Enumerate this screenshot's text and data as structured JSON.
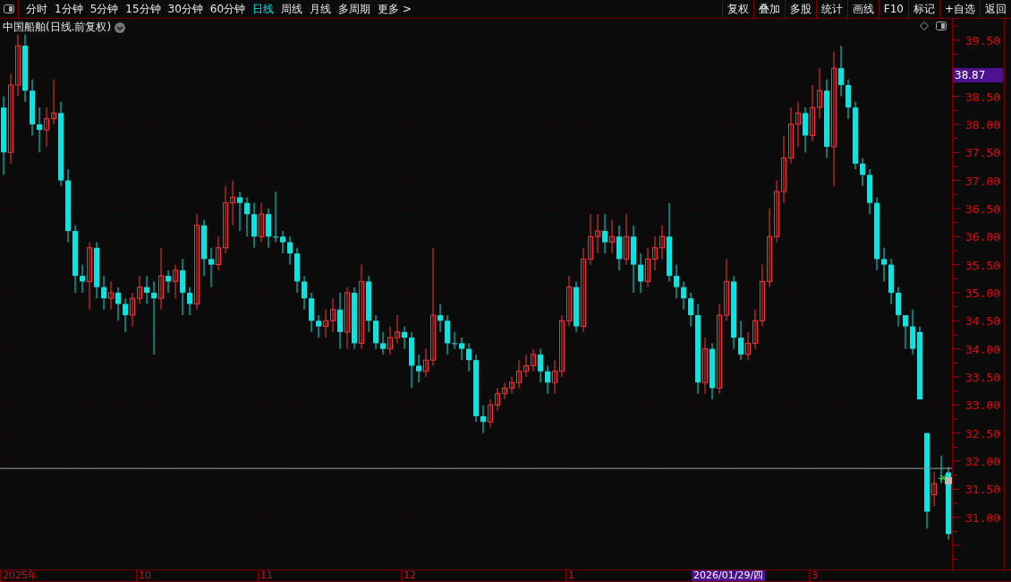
{
  "toolbar": {
    "periods": [
      {
        "label": "分时",
        "selected": false
      },
      {
        "label": "1分钟",
        "selected": false
      },
      {
        "label": "5分钟",
        "selected": false
      },
      {
        "label": "15分钟",
        "selected": false
      },
      {
        "label": "30分钟",
        "selected": false
      },
      {
        "label": "60分钟",
        "selected": false
      },
      {
        "label": "日线",
        "selected": true
      },
      {
        "label": "周线",
        "selected": false
      },
      {
        "label": "月线",
        "selected": false
      },
      {
        "label": "多周期",
        "selected": false
      },
      {
        "label": "更多 >",
        "selected": false
      }
    ],
    "buttons": [
      "复权",
      "叠加",
      "多股",
      "统计",
      "画线",
      "F10",
      "标记",
      "+自选",
      "返回"
    ]
  },
  "chart": {
    "title": "中国船舶(日线.前复权)",
    "date_labels": [
      "2025年",
      "10",
      "11",
      "12",
      "1",
      "3"
    ],
    "cursor_price": "38.87",
    "cursor_date": "2026/01/29/四",
    "chart_data": {
      "type": "candlestick",
      "ylim": [
        30.07,
        39.88
      ],
      "grid": true,
      "yticks": [
        {
          "value": 31,
          "label": "31.00"
        },
        {
          "value": 31.5,
          "label": "31.50"
        },
        {
          "value": 32,
          "label": "32.00"
        },
        {
          "value": 32.5,
          "label": "32.50"
        },
        {
          "value": 33,
          "label": "33.00"
        },
        {
          "value": 33.5,
          "label": "33.50"
        },
        {
          "value": 34,
          "label": "34.00"
        },
        {
          "value": 34.5,
          "label": "34.50"
        },
        {
          "value": 35,
          "label": "35.00"
        },
        {
          "value": 35.5,
          "label": "35.50"
        },
        {
          "value": 36,
          "label": "36.00"
        },
        {
          "value": 36.5,
          "label": "36.50"
        },
        {
          "value": 37,
          "label": "37.00"
        },
        {
          "value": 37.5,
          "label": "37.50"
        },
        {
          "value": 38,
          "label": "38.00"
        },
        {
          "value": 38.5,
          "label": "38.50"
        },
        {
          "value": 39.5,
          "label": "39.50"
        }
      ],
      "ref_lines": [
        {
          "axis": "y",
          "value": 31.87
        }
      ],
      "categories": [
        null,
        null,
        null,
        null,
        null,
        null,
        null,
        null,
        null,
        null,
        null,
        null,
        null,
        null,
        null,
        null,
        null,
        null,
        null,
        null,
        null,
        null,
        null,
        null,
        null,
        null,
        null,
        null,
        null,
        null,
        null,
        null,
        null,
        null,
        null,
        null,
        null,
        null,
        null,
        null,
        null,
        null,
        null,
        null,
        null,
        null,
        null,
        null,
        null,
        null,
        null,
        null,
        null,
        null,
        null,
        null,
        null,
        null,
        null,
        null,
        null,
        null,
        null,
        null,
        null,
        null,
        null,
        null,
        null,
        null,
        null,
        null,
        null,
        null,
        null,
        null,
        null,
        null,
        null,
        null,
        null,
        null,
        null,
        null,
        null,
        null,
        null,
        null,
        null,
        null,
        null,
        null,
        null,
        null,
        null,
        null,
        null,
        null,
        null,
        null,
        null,
        null,
        null,
        null,
        null,
        null,
        null,
        null,
        null,
        null,
        null,
        null,
        null,
        null,
        null,
        null,
        null,
        null,
        null,
        null,
        null,
        null,
        null,
        null,
        null,
        null,
        null,
        null,
        null,
        null,
        null,
        null,
        null
      ],
      "ohlc": [
        [
          38.3,
          38.5,
          37.1,
          37.5
        ],
        [
          37.5,
          38.9,
          37.3,
          38.7
        ],
        [
          38.7,
          39.6,
          38.5,
          39.4
        ],
        [
          39.4,
          39.6,
          38.4,
          38.6
        ],
        [
          38.6,
          38.8,
          37.8,
          38.0
        ],
        [
          38.0,
          38.3,
          37.5,
          37.9
        ],
        [
          37.9,
          38.3,
          37.6,
          38.1
        ],
        [
          38.1,
          38.8,
          38.0,
          38.2
        ],
        [
          38.2,
          38.4,
          36.9,
          37.0
        ],
        [
          37.0,
          37.2,
          35.9,
          36.1
        ],
        [
          36.1,
          36.2,
          35.0,
          35.3
        ],
        [
          35.3,
          35.5,
          35.0,
          35.2
        ],
        [
          35.2,
          35.9,
          34.7,
          35.8
        ],
        [
          35.8,
          35.9,
          34.9,
          35.1
        ],
        [
          35.1,
          35.3,
          34.7,
          34.9
        ],
        [
          34.9,
          35.2,
          34.7,
          35.0
        ],
        [
          35.0,
          35.1,
          34.5,
          34.8
        ],
        [
          34.8,
          34.9,
          34.3,
          34.6
        ],
        [
          34.6,
          35.0,
          34.4,
          34.9
        ],
        [
          34.9,
          35.3,
          34.8,
          35.1
        ],
        [
          35.1,
          35.3,
          34.8,
          35.0
        ],
        [
          35.0,
          35.2,
          33.9,
          34.9
        ],
        [
          34.9,
          35.8,
          34.7,
          35.3
        ],
        [
          35.3,
          35.4,
          35.0,
          35.2
        ],
        [
          35.2,
          35.5,
          34.9,
          35.4
        ],
        [
          35.4,
          35.6,
          34.6,
          35.0
        ],
        [
          35.0,
          35.1,
          34.6,
          34.8
        ],
        [
          34.8,
          36.4,
          34.7,
          36.2
        ],
        [
          36.2,
          36.3,
          35.3,
          35.6
        ],
        [
          35.6,
          35.8,
          35.1,
          35.5
        ],
        [
          35.5,
          36.0,
          35.4,
          35.8
        ],
        [
          35.8,
          36.9,
          35.7,
          36.6
        ],
        [
          36.6,
          37.0,
          36.2,
          36.7
        ],
        [
          36.7,
          36.8,
          36.1,
          36.6
        ],
        [
          36.6,
          36.7,
          36.0,
          36.4
        ],
        [
          36.4,
          36.6,
          35.8,
          36.0
        ],
        [
          36.0,
          36.6,
          35.9,
          36.4
        ],
        [
          36.4,
          36.5,
          35.8,
          36.0
        ],
        [
          36.0,
          36.8,
          35.9,
          36.0
        ],
        [
          36.0,
          36.1,
          35.7,
          35.9
        ],
        [
          35.9,
          36.0,
          35.5,
          35.7
        ],
        [
          35.7,
          35.8,
          35.0,
          35.2
        ],
        [
          35.2,
          35.3,
          34.7,
          34.9
        ],
        [
          34.9,
          35.0,
          34.3,
          34.5
        ],
        [
          34.5,
          34.6,
          34.2,
          34.4
        ],
        [
          34.4,
          34.7,
          34.2,
          34.5
        ],
        [
          34.5,
          34.9,
          34.3,
          34.7
        ],
        [
          34.7,
          35.0,
          34.0,
          34.3
        ],
        [
          34.3,
          35.1,
          34.0,
          35.0
        ],
        [
          35.0,
          35.1,
          34.0,
          34.1
        ],
        [
          34.1,
          35.5,
          34.0,
          35.2
        ],
        [
          35.2,
          35.3,
          34.3,
          34.5
        ],
        [
          34.5,
          34.6,
          34.0,
          34.1
        ],
        [
          34.1,
          34.3,
          33.9,
          34.0
        ],
        [
          34.0,
          34.4,
          33.9,
          34.2
        ],
        [
          34.2,
          34.6,
          34.1,
          34.3
        ],
        [
          34.3,
          34.4,
          34.0,
          34.2
        ],
        [
          34.2,
          34.3,
          33.3,
          33.7
        ],
        [
          33.7,
          33.9,
          33.4,
          33.6
        ],
        [
          33.6,
          34.0,
          33.5,
          33.8
        ],
        [
          33.8,
          35.8,
          33.7,
          34.6
        ],
        [
          34.6,
          34.8,
          34.3,
          34.5
        ],
        [
          34.5,
          34.6,
          33.9,
          34.1
        ],
        [
          34.1,
          34.3,
          34.0,
          34.1
        ],
        [
          34.1,
          34.2,
          33.8,
          34.0
        ],
        [
          34.0,
          34.1,
          33.6,
          33.8
        ],
        [
          33.8,
          33.9,
          32.7,
          32.8
        ],
        [
          32.8,
          33.0,
          32.5,
          32.7
        ],
        [
          32.7,
          33.1,
          32.6,
          33.0
        ],
        [
          33.0,
          33.3,
          32.9,
          33.2
        ],
        [
          33.2,
          33.4,
          33.1,
          33.3
        ],
        [
          33.3,
          33.5,
          33.2,
          33.4
        ],
        [
          33.4,
          33.8,
          33.3,
          33.6
        ],
        [
          33.6,
          33.9,
          33.5,
          33.7
        ],
        [
          33.7,
          34.0,
          33.6,
          33.9
        ],
        [
          33.9,
          34.0,
          33.4,
          33.6
        ],
        [
          33.6,
          33.7,
          33.2,
          33.4
        ],
        [
          33.4,
          33.8,
          33.2,
          33.6
        ],
        [
          33.6,
          34.6,
          33.5,
          34.5
        ],
        [
          34.5,
          35.3,
          34.4,
          35.1
        ],
        [
          35.1,
          35.2,
          34.3,
          34.4
        ],
        [
          34.4,
          35.8,
          34.3,
          35.6
        ],
        [
          35.6,
          36.4,
          35.5,
          36.0
        ],
        [
          36.0,
          36.4,
          35.7,
          36.1
        ],
        [
          36.1,
          36.4,
          35.7,
          35.9
        ],
        [
          35.9,
          36.3,
          35.7,
          36.0
        ],
        [
          36.0,
          36.2,
          35.4,
          35.6
        ],
        [
          35.6,
          36.4,
          35.5,
          36.0
        ],
        [
          36.0,
          36.2,
          35.0,
          35.5
        ],
        [
          35.5,
          35.7,
          35.0,
          35.2
        ],
        [
          35.2,
          35.8,
          35.1,
          35.6
        ],
        [
          35.6,
          36.0,
          35.4,
          35.8
        ],
        [
          35.8,
          36.2,
          35.6,
          36.0
        ],
        [
          36.0,
          36.6,
          35.2,
          35.3
        ],
        [
          35.3,
          35.5,
          34.9,
          35.1
        ],
        [
          35.1,
          35.2,
          34.7,
          34.9
        ],
        [
          34.9,
          35.0,
          34.4,
          34.6
        ],
        [
          34.6,
          34.8,
          33.2,
          33.4
        ],
        [
          33.4,
          34.2,
          33.2,
          34.0
        ],
        [
          34.0,
          34.1,
          33.1,
          33.3
        ],
        [
          33.3,
          34.8,
          33.2,
          34.6
        ],
        [
          34.6,
          35.6,
          34.5,
          35.2
        ],
        [
          35.2,
          35.3,
          34.0,
          34.2
        ],
        [
          34.2,
          34.5,
          33.8,
          33.9
        ],
        [
          33.9,
          34.3,
          33.8,
          34.1
        ],
        [
          34.1,
          34.7,
          34.0,
          34.5
        ],
        [
          34.5,
          35.5,
          34.4,
          35.2
        ],
        [
          35.2,
          36.5,
          35.1,
          36.0
        ],
        [
          36.0,
          37.0,
          35.9,
          36.8
        ],
        [
          36.8,
          37.8,
          36.6,
          37.4
        ],
        [
          37.4,
          38.3,
          37.3,
          38.0
        ],
        [
          38.0,
          38.4,
          37.6,
          38.2
        ],
        [
          38.2,
          38.3,
          37.5,
          37.8
        ],
        [
          37.8,
          38.7,
          37.7,
          38.3
        ],
        [
          38.3,
          39.0,
          38.1,
          38.6
        ],
        [
          38.6,
          38.8,
          37.4,
          37.6
        ],
        [
          37.6,
          39.3,
          36.9,
          39.0
        ],
        [
          39.0,
          39.4,
          38.5,
          38.7
        ],
        [
          38.7,
          38.8,
          38.1,
          38.3
        ],
        [
          38.3,
          38.4,
          37.2,
          37.3
        ],
        [
          37.3,
          37.4,
          36.9,
          37.1
        ],
        [
          37.1,
          37.2,
          36.4,
          36.6
        ],
        [
          36.6,
          36.7,
          35.4,
          35.6
        ],
        [
          35.6,
          35.8,
          35.2,
          35.5
        ],
        [
          35.5,
          35.6,
          34.8,
          35.0
        ],
        [
          35.0,
          35.1,
          34.4,
          34.6
        ],
        [
          34.6,
          34.6,
          34.0,
          34.4
        ],
        [
          34.4,
          34.7,
          33.9,
          34.0
        ],
        [
          34.3,
          34.4,
          33.1,
          33.1
        ],
        [
          32.5,
          32.5,
          30.8,
          31.1
        ],
        [
          31.4,
          31.8,
          31.2,
          31.6
        ],
        [
          31.7,
          32.1,
          31.6,
          31.7
        ],
        [
          31.8,
          31.9,
          30.6,
          30.7
        ]
      ]
    }
  }
}
